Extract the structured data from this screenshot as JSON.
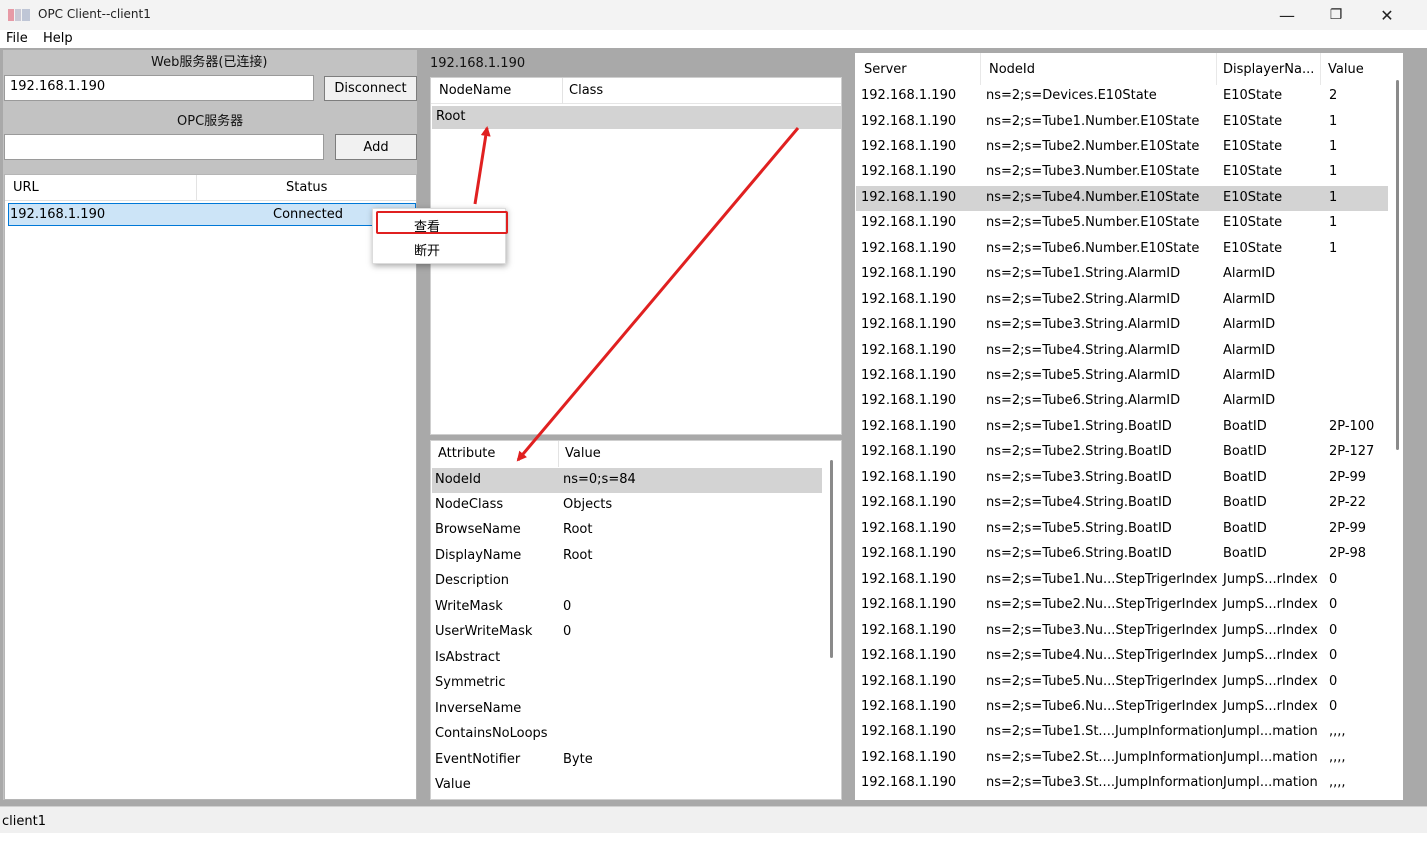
{
  "window": {
    "title": "OPC Client--client1",
    "minimize": "—",
    "restore": "❐",
    "close": "✕"
  },
  "menu": {
    "file": "File",
    "help": "Help"
  },
  "left": {
    "web_server_label": "Web服务器(已连接)",
    "web_server_value": "192.168.1.190",
    "disconnect_label": "Disconnect",
    "opc_server_label": "OPC服务器",
    "opc_server_value": "",
    "add_label": "Add",
    "table": {
      "col_url": "URL",
      "col_status": "Status",
      "rows": [
        {
          "url": "192.168.1.190",
          "status": "Connected"
        }
      ]
    }
  },
  "context_menu": {
    "view": "查看",
    "disconnect": "断开"
  },
  "middle": {
    "server_title": "192.168.1.190",
    "tree": {
      "col_nodename": "NodeName",
      "col_class": "Class",
      "root": "Root"
    },
    "attributes": {
      "col_attribute": "Attribute",
      "col_value": "Value",
      "rows": [
        {
          "name": "NodeId",
          "value": "ns=0;s=84"
        },
        {
          "name": "NodeClass",
          "value": "Objects"
        },
        {
          "name": "BrowseName",
          "value": "Root"
        },
        {
          "name": "DisplayName",
          "value": "Root"
        },
        {
          "name": "Description",
          "value": ""
        },
        {
          "name": "WriteMask",
          "value": "0"
        },
        {
          "name": "UserWriteMask",
          "value": "0"
        },
        {
          "name": "IsAbstract",
          "value": ""
        },
        {
          "name": "Symmetric",
          "value": ""
        },
        {
          "name": "InverseName",
          "value": ""
        },
        {
          "name": "ContainsNoLoops",
          "value": ""
        },
        {
          "name": "EventNotifier",
          "value": "Byte"
        },
        {
          "name": "Value",
          "value": ""
        }
      ]
    }
  },
  "right": {
    "col_server": "Server",
    "col_nodeid": "NodeId",
    "col_display": "DisplayerNa...",
    "col_value": "Value",
    "rows": [
      {
        "server": "192.168.1.190",
        "nodeid": "ns=2;s=Devices.E10State",
        "display": "E10State",
        "value": "2"
      },
      {
        "server": "192.168.1.190",
        "nodeid": "ns=2;s=Tube1.Number.E10State",
        "display": "E10State",
        "value": "1"
      },
      {
        "server": "192.168.1.190",
        "nodeid": "ns=2;s=Tube2.Number.E10State",
        "display": "E10State",
        "value": "1"
      },
      {
        "server": "192.168.1.190",
        "nodeid": "ns=2;s=Tube3.Number.E10State",
        "display": "E10State",
        "value": "1"
      },
      {
        "server": "192.168.1.190",
        "nodeid": "ns=2;s=Tube4.Number.E10State",
        "display": "E10State",
        "value": "1"
      },
      {
        "server": "192.168.1.190",
        "nodeid": "ns=2;s=Tube5.Number.E10State",
        "display": "E10State",
        "value": "1"
      },
      {
        "server": "192.168.1.190",
        "nodeid": "ns=2;s=Tube6.Number.E10State",
        "display": "E10State",
        "value": "1"
      },
      {
        "server": "192.168.1.190",
        "nodeid": "ns=2;s=Tube1.String.AlarmID",
        "display": "AlarmID",
        "value": ""
      },
      {
        "server": "192.168.1.190",
        "nodeid": "ns=2;s=Tube2.String.AlarmID",
        "display": "AlarmID",
        "value": ""
      },
      {
        "server": "192.168.1.190",
        "nodeid": "ns=2;s=Tube3.String.AlarmID",
        "display": "AlarmID",
        "value": ""
      },
      {
        "server": "192.168.1.190",
        "nodeid": "ns=2;s=Tube4.String.AlarmID",
        "display": "AlarmID",
        "value": ""
      },
      {
        "server": "192.168.1.190",
        "nodeid": "ns=2;s=Tube5.String.AlarmID",
        "display": "AlarmID",
        "value": ""
      },
      {
        "server": "192.168.1.190",
        "nodeid": "ns=2;s=Tube6.String.AlarmID",
        "display": "AlarmID",
        "value": ""
      },
      {
        "server": "192.168.1.190",
        "nodeid": "ns=2;s=Tube1.String.BoatID",
        "display": "BoatID",
        "value": "2P-100"
      },
      {
        "server": "192.168.1.190",
        "nodeid": "ns=2;s=Tube2.String.BoatID",
        "display": "BoatID",
        "value": "2P-127"
      },
      {
        "server": "192.168.1.190",
        "nodeid": "ns=2;s=Tube3.String.BoatID",
        "display": "BoatID",
        "value": "2P-99"
      },
      {
        "server": "192.168.1.190",
        "nodeid": "ns=2;s=Tube4.String.BoatID",
        "display": "BoatID",
        "value": "2P-22"
      },
      {
        "server": "192.168.1.190",
        "nodeid": "ns=2;s=Tube5.String.BoatID",
        "display": "BoatID",
        "value": "2P-99"
      },
      {
        "server": "192.168.1.190",
        "nodeid": "ns=2;s=Tube6.String.BoatID",
        "display": "BoatID",
        "value": "2P-98"
      },
      {
        "server": "192.168.1.190",
        "nodeid": "ns=2;s=Tube1.Nu...StepTrigerIndex",
        "display": "JumpS...rIndex",
        "value": "0"
      },
      {
        "server": "192.168.1.190",
        "nodeid": "ns=2;s=Tube2.Nu...StepTrigerIndex",
        "display": "JumpS...rIndex",
        "value": "0"
      },
      {
        "server": "192.168.1.190",
        "nodeid": "ns=2;s=Tube3.Nu...StepTrigerIndex",
        "display": "JumpS...rIndex",
        "value": "0"
      },
      {
        "server": "192.168.1.190",
        "nodeid": "ns=2;s=Tube4.Nu...StepTrigerIndex",
        "display": "JumpS...rIndex",
        "value": "0"
      },
      {
        "server": "192.168.1.190",
        "nodeid": "ns=2;s=Tube5.Nu...StepTrigerIndex",
        "display": "JumpS...rIndex",
        "value": "0"
      },
      {
        "server": "192.168.1.190",
        "nodeid": "ns=2;s=Tube6.Nu...StepTrigerIndex",
        "display": "JumpS...rIndex",
        "value": "0"
      },
      {
        "server": "192.168.1.190",
        "nodeid": "ns=2;s=Tube1.St....JumpInformation",
        "display": "JumpI...mation",
        "value": ",,,,"
      },
      {
        "server": "192.168.1.190",
        "nodeid": "ns=2;s=Tube2.St....JumpInformation",
        "display": "JumpI...mation",
        "value": ",,,,"
      },
      {
        "server": "192.168.1.190",
        "nodeid": "ns=2;s=Tube3.St....JumpInformation",
        "display": "JumpI...mation",
        "value": ",,,,"
      }
    ]
  },
  "status": {
    "text": "client1"
  },
  "colors": {
    "selection": "#cce4f7",
    "selection_border": "#0078d7",
    "row_highlight": "#d3d3d3",
    "annotation_red": "#e02020"
  }
}
